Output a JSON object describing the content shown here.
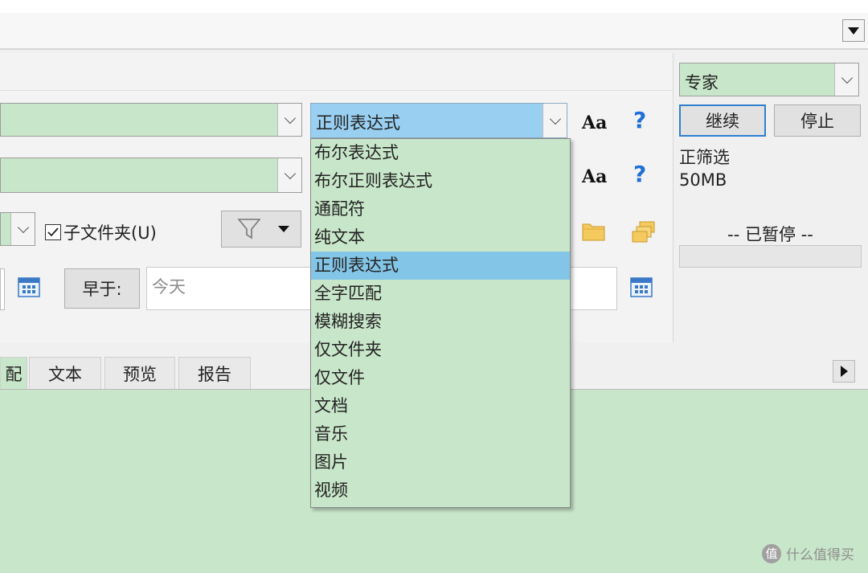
{
  "search_type_combo": {
    "value": "正则表达式"
  },
  "dropdown": {
    "items": [
      "布尔表达式",
      "布尔正则表达式",
      "通配符",
      "纯文本",
      "正则表达式",
      "全字匹配",
      "模糊搜索",
      "仅文件夹",
      "仅文件",
      "文档",
      "音乐",
      "图片",
      "视频"
    ],
    "selected": "正则表达式"
  },
  "options": {
    "aa_label": "Aa",
    "help_label": "?"
  },
  "subfolders": {
    "label": "子文件夹(U)",
    "checked": true
  },
  "date": {
    "before_label": "早于:",
    "before_value": "今天"
  },
  "right_panel": {
    "mode": "专家",
    "continue": "继续",
    "stop": "停止",
    "filter_status": "正筛选",
    "size": "50MB",
    "status": "-- 已暂停 --"
  },
  "tabs": [
    "配",
    "文本",
    "预览",
    "报告"
  ],
  "watermark": {
    "icon_text": "值",
    "text": "什么值得买"
  },
  "colors": {
    "green": "#c8e6c9",
    "highlight": "#83c5e6",
    "help_blue": "#1f6fd6"
  }
}
